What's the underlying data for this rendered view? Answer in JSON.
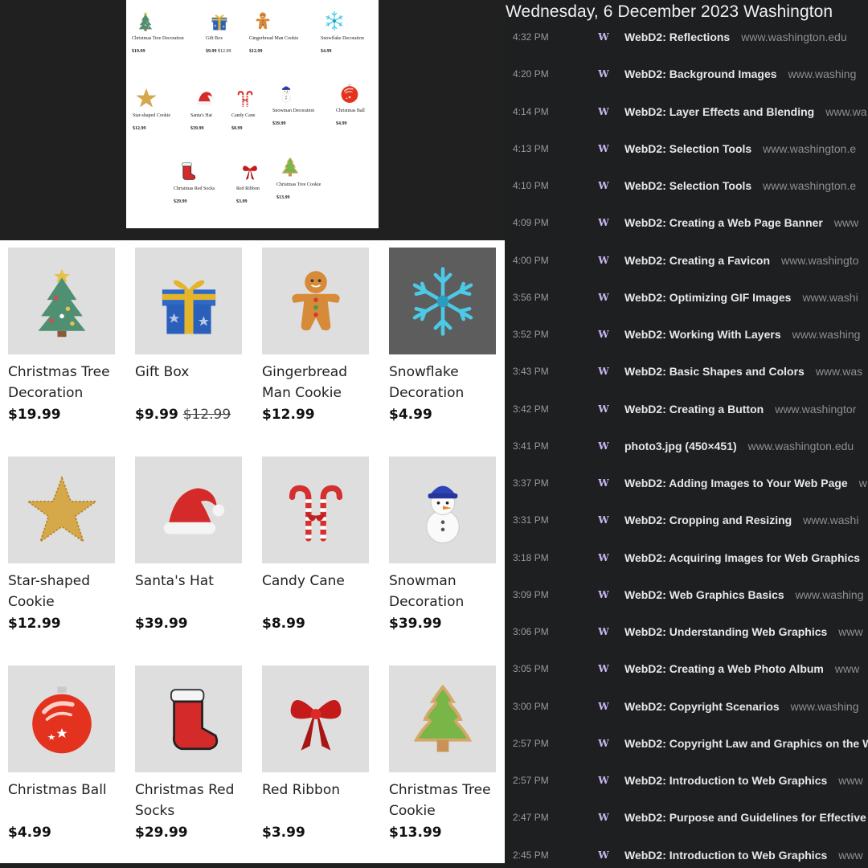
{
  "thumbnail_page": {
    "products": [
      {
        "name": "Christmas Tree Decoration",
        "price": "$19.99",
        "old_price": "",
        "icon": "tree-icon"
      },
      {
        "name": "Gift Box",
        "price": "$9.99",
        "old_price": "$12.99",
        "icon": "gift-icon"
      },
      {
        "name": "Gingerbread Man Cookie",
        "price": "$12.99",
        "old_price": "",
        "icon": "gingerbread-icon"
      },
      {
        "name": "Snowflake Decoration",
        "price": "$4.99",
        "old_price": "",
        "icon": "snowflake-icon"
      },
      {
        "name": "Star-shaped Cookie",
        "price": "$12.99",
        "old_price": "",
        "icon": "star-icon"
      },
      {
        "name": "Santa's Hat",
        "price": "$39.99",
        "old_price": "",
        "icon": "santa-hat-icon"
      },
      {
        "name": "Candy Cane",
        "price": "$8.99",
        "old_price": "",
        "icon": "candy-cane-icon"
      },
      {
        "name": "Snowman Decoration",
        "price": "$39.99",
        "old_price": "",
        "icon": "snowman-icon"
      },
      {
        "name": "Christmas Ball",
        "price": "$4.99",
        "old_price": "",
        "icon": "ornament-ball-icon"
      },
      {
        "name": "Christmas Red Socks",
        "price": "$29.99",
        "old_price": "",
        "icon": "stocking-icon"
      },
      {
        "name": "Red Ribbon",
        "price": "$3.99",
        "old_price": "",
        "icon": "ribbon-icon"
      },
      {
        "name": "Christmas Tree Cookie",
        "price": "$13.99",
        "old_price": "",
        "icon": "tree-cookie-icon"
      }
    ]
  },
  "product_grid": {
    "products": [
      {
        "name": "Christmas Tree Decoration",
        "price": "$19.99",
        "old_price": "",
        "icon": "tree-icon"
      },
      {
        "name": "Gift Box",
        "price": "$9.99",
        "old_price": "$12.99",
        "icon": "gift-icon"
      },
      {
        "name": "Gingerbread Man Cookie",
        "price": "$12.99",
        "old_price": "",
        "icon": "gingerbread-icon"
      },
      {
        "name": "Snowflake Decoration",
        "price": "$4.99",
        "old_price": "",
        "icon": "snowflake-icon"
      },
      {
        "name": "Star-shaped Cookie",
        "price": "$12.99",
        "old_price": "",
        "icon": "star-icon"
      },
      {
        "name": "Santa's Hat",
        "price": "$39.99",
        "old_price": "",
        "icon": "santa-hat-icon"
      },
      {
        "name": "Candy Cane",
        "price": "$8.99",
        "old_price": "",
        "icon": "candy-cane-icon"
      },
      {
        "name": "Snowman Decoration",
        "price": "$39.99",
        "old_price": "",
        "icon": "snowman-icon"
      },
      {
        "name": "Christmas Ball",
        "price": "$4.99",
        "old_price": "",
        "icon": "ornament-ball-icon"
      },
      {
        "name": "Christmas Red Socks",
        "price": "$29.99",
        "old_price": "",
        "icon": "stocking-icon"
      },
      {
        "name": "Red Ribbon",
        "price": "$3.99",
        "old_price": "",
        "icon": "ribbon-icon"
      },
      {
        "name": "Christmas Tree Cookie",
        "price": "$13.99",
        "old_price": "",
        "icon": "tree-cookie-icon"
      }
    ]
  },
  "history": {
    "date_heading": "Wednesday, 6 December 2023 Washington",
    "favicon_letter": "W",
    "entries": [
      {
        "time": "4:32 PM",
        "title": "WebD2: Reflections",
        "url": "www.washington.edu"
      },
      {
        "time": "4:20 PM",
        "title": "WebD2: Background Images",
        "url": "www.washing"
      },
      {
        "time": "4:14 PM",
        "title": "WebD2: Layer Effects and Blending",
        "url": "www.wa"
      },
      {
        "time": "4:13 PM",
        "title": "WebD2: Selection Tools",
        "url": "www.washington.e"
      },
      {
        "time": "4:10 PM",
        "title": "WebD2: Selection Tools",
        "url": "www.washington.e"
      },
      {
        "time": "4:09 PM",
        "title": "WebD2: Creating a Web Page Banner",
        "url": "www"
      },
      {
        "time": "4:00 PM",
        "title": "WebD2: Creating a Favicon",
        "url": "www.washingto"
      },
      {
        "time": "3:56 PM",
        "title": "WebD2: Optimizing GIF Images",
        "url": "www.washi"
      },
      {
        "time": "3:52 PM",
        "title": "WebD2: Working With Layers",
        "url": "www.washing"
      },
      {
        "time": "3:43 PM",
        "title": "WebD2: Basic Shapes and Colors",
        "url": "www.was"
      },
      {
        "time": "3:42 PM",
        "title": "WebD2: Creating a Button",
        "url": "www.washingtor"
      },
      {
        "time": "3:41 PM",
        "title": "photo3.jpg (450×451)",
        "url": "www.washington.edu"
      },
      {
        "time": "3:37 PM",
        "title": "WebD2: Adding Images to Your Web Page",
        "url": "w"
      },
      {
        "time": "3:31 PM",
        "title": "WebD2: Cropping and Resizing",
        "url": "www.washi"
      },
      {
        "time": "3:18 PM",
        "title": "WebD2: Acquiring Images for Web Graphics",
        "url": ""
      },
      {
        "time": "3:09 PM",
        "title": "WebD2: Web Graphics Basics",
        "url": "www.washing"
      },
      {
        "time": "3:06 PM",
        "title": "WebD2: Understanding Web Graphics",
        "url": "www"
      },
      {
        "time": "3:05 PM",
        "title": "WebD2: Creating a Web Photo Album",
        "url": "www"
      },
      {
        "time": "3:00 PM",
        "title": "WebD2: Copyright Scenarios",
        "url": "www.washing"
      },
      {
        "time": "2:57 PM",
        "title": "WebD2: Copyright Law and Graphics on the W",
        "url": ""
      },
      {
        "time": "2:57 PM",
        "title": "WebD2: Introduction to Web Graphics",
        "url": "www"
      },
      {
        "time": "2:47 PM",
        "title": "WebD2: Purpose and Guidelines for Effective",
        "url": ""
      },
      {
        "time": "2:45 PM",
        "title": "WebD2: Introduction to Web Graphics",
        "url": "www"
      }
    ]
  }
}
